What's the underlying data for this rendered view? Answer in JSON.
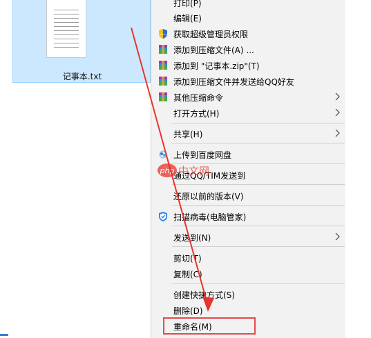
{
  "file": {
    "name": "记事本.txt"
  },
  "menu": {
    "items": [
      {
        "label": "打印(P)",
        "icon": "none",
        "submenu": false
      },
      {
        "label": "编辑(E)",
        "icon": "none",
        "submenu": false
      },
      {
        "label": "获取超级管理员权限",
        "icon": "shield-icon",
        "submenu": false
      },
      {
        "label": "添加到压缩文件(A) ...",
        "icon": "winrar-icon",
        "submenu": false
      },
      {
        "label": "添加到 \"记事本.zip\"(T)",
        "icon": "winrar-icon",
        "submenu": false
      },
      {
        "label": "添加到压缩文件并发送给QQ好友",
        "icon": "winrar-icon",
        "submenu": false
      },
      {
        "label": "其他压缩命令",
        "icon": "winrar-icon",
        "submenu": true
      },
      {
        "label": "打开方式(H)",
        "icon": "none",
        "submenu": true
      },
      {
        "label": "共享(H)",
        "icon": "none",
        "submenu": true
      },
      {
        "label": "上传到百度网盘",
        "icon": "baidu-cloud-icon",
        "submenu": false
      },
      {
        "label": "通过QQ/TIM发送到",
        "icon": "none",
        "submenu": false
      },
      {
        "label": "还原以前的版本(V)",
        "icon": "none",
        "submenu": false
      },
      {
        "label": "扫描病毒(电脑管家)",
        "icon": "tencent-guard-icon",
        "submenu": false
      },
      {
        "label": "发送到(N)",
        "icon": "none",
        "submenu": true
      },
      {
        "label": "剪切(T)",
        "icon": "none",
        "submenu": false
      },
      {
        "label": "复制(C)",
        "icon": "none",
        "submenu": false
      },
      {
        "label": "创建快捷方式(S)",
        "icon": "none",
        "submenu": false
      },
      {
        "label": "删除(D)",
        "icon": "none",
        "submenu": false
      },
      {
        "label": "重命名(M)",
        "icon": "none",
        "submenu": false
      }
    ]
  },
  "watermark": {
    "text": "中文网",
    "logo_text": "php"
  },
  "colors": {
    "highlight": "#e34a4a",
    "selection": "#cce8ff",
    "menu_bg": "#f2f2f2"
  }
}
